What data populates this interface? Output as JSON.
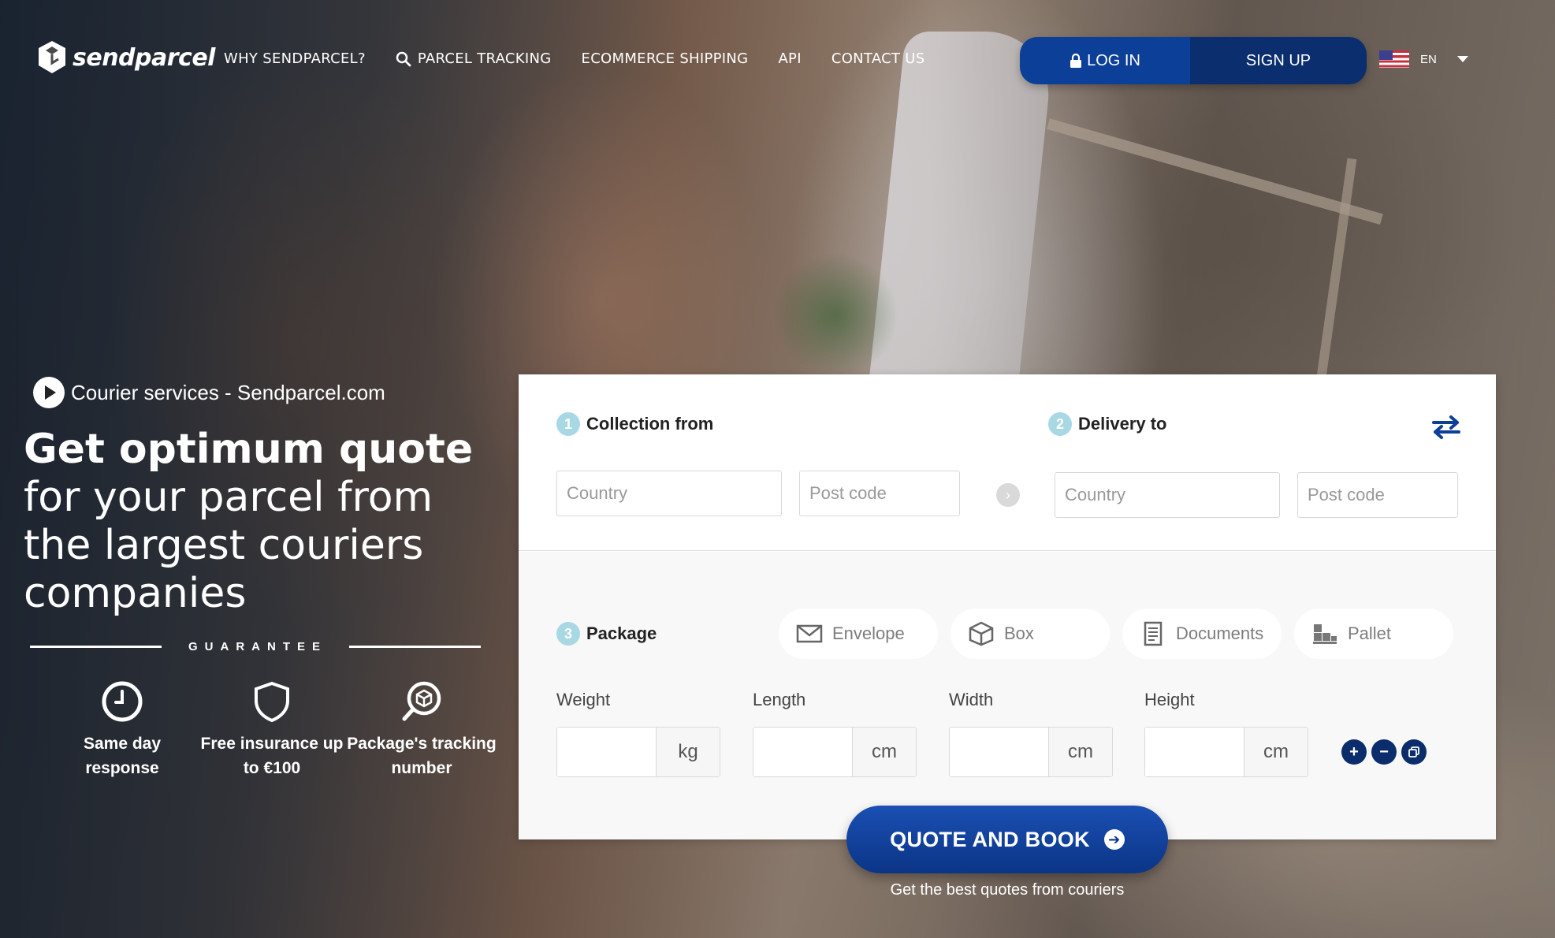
{
  "brand": {
    "name": "sendparcel"
  },
  "nav": {
    "items": [
      "WHY SENDPARCEL?",
      "PARCEL TRACKING",
      "ECOMMERCE SHIPPING",
      "API",
      "CONTACT US"
    ],
    "tracking_icon": "search-icon"
  },
  "auth": {
    "login_label": "LOG IN",
    "signup_label": "SIGN UP"
  },
  "language": {
    "code": "EN",
    "flag": "us-flag"
  },
  "hero": {
    "video_link": "Courier services - Sendparcel.com",
    "headline_bold": "Get optimum quote",
    "headline_rest": " for your parcel from the largest couriers companies",
    "guarantee_label": "GUARANTEE",
    "perks": [
      {
        "label": "Same day response",
        "icon": "clock-icon"
      },
      {
        "label": "Free insurance up to €100",
        "icon": "shield-icon"
      },
      {
        "label": "Package's tracking number",
        "icon": "tracking-icon"
      }
    ]
  },
  "form": {
    "step1": {
      "num": "1",
      "label": "Collection from"
    },
    "step2": {
      "num": "2",
      "label": "Delivery to"
    },
    "step3": {
      "num": "3",
      "label": "Package"
    },
    "collection": {
      "country_placeholder": "Country",
      "postcode_placeholder": "Post code"
    },
    "delivery": {
      "country_placeholder": "Country",
      "postcode_placeholder": "Post code"
    },
    "package_types": [
      {
        "label": "Envelope",
        "icon": "envelope-icon"
      },
      {
        "label": "Box",
        "icon": "box-icon"
      },
      {
        "label": "Documents",
        "icon": "documents-icon"
      },
      {
        "label": "Pallet",
        "icon": "pallet-icon"
      }
    ],
    "dimensions": [
      {
        "label": "Weight",
        "unit": "kg"
      },
      {
        "label": "Length",
        "unit": "cm"
      },
      {
        "label": "Width",
        "unit": "cm"
      },
      {
        "label": "Height",
        "unit": "cm"
      }
    ]
  },
  "cta": {
    "label": "QUOTE AND BOOK",
    "sub": "Get the best quotes from couriers"
  },
  "colors": {
    "primary": "#0c3f98",
    "dark": "#0a2e6e",
    "step_badge": "#a8d8e4"
  }
}
